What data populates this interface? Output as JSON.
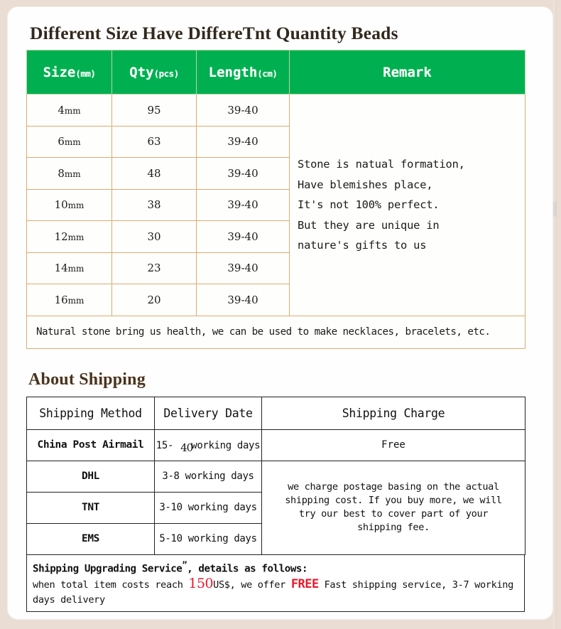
{
  "size_section": {
    "title": "Different Size Have DiffereTnt Quantity Beads",
    "columns": {
      "size": {
        "main": "Size",
        "unit": "(mm)"
      },
      "qty": {
        "main": "Qty",
        "unit": "(pcs)"
      },
      "length": {
        "main": "Length",
        "unit": "(cm)"
      },
      "remark": "Remark"
    },
    "rows": [
      {
        "size": "4",
        "size_unit": "mm",
        "qty": "95",
        "length": "39-40"
      },
      {
        "size": "6",
        "size_unit": "mm",
        "qty": "63",
        "length": "39-40"
      },
      {
        "size": "8",
        "size_unit": "mm",
        "qty": "48",
        "length": "39-40"
      },
      {
        "size": "10",
        "size_unit": "mm",
        "qty": "38",
        "length": "39-40"
      },
      {
        "size": "12",
        "size_unit": "mm",
        "qty": "30",
        "length": "39-40"
      },
      {
        "size": "14",
        "size_unit": "mm",
        "qty": "23",
        "length": "39-40"
      },
      {
        "size": "16",
        "size_unit": "mm",
        "qty": "20",
        "length": "39-40"
      }
    ],
    "remark_text": "Stone is natual formation,\nHave blemishes place,\nIt's not 100% perfect.\nBut they are unique in\nnature's gifts to us",
    "footer_note": "Natural stone bring us health, we can be used to make necklaces, bracelets, etc."
  },
  "shipping_section": {
    "title": "About Shipping",
    "columns": {
      "method": "Shipping Method",
      "date": "Delivery Date",
      "charge": "Shipping Charge"
    },
    "rows": [
      {
        "method": "China Post Airmail",
        "date_prefix": "15-",
        "date_alt": "40",
        "date_suffix": "working days"
      },
      {
        "method": "DHL",
        "date": "3-8 working days"
      },
      {
        "method": "TNT",
        "date": "3-10 working days"
      },
      {
        "method": "EMS",
        "date": "5-10 working days"
      }
    ],
    "charge_free": "Free",
    "charge_note": "we charge postage basing on the actual shipping cost. If you buy more, we will try our best to cover part of your shipping fee."
  },
  "footer": {
    "line1_text": "Shipping Upgrading Service",
    "line1_mark": "”",
    "line1_rest": ", details as follows:",
    "line2_a": "when total item costs reach ",
    "line2_amount": "150",
    "line2_b": "US$, we offer ",
    "line2_free": "FREE",
    "line2_c": " Fast shipping service, 3-7 working days delivery"
  },
  "colors": {
    "header_green": "#00b050",
    "table_border_tan": "#dcab72",
    "accent_red": "#e8192c",
    "frame_beige": "#e9ddd4",
    "title_brown": "#32291c"
  }
}
